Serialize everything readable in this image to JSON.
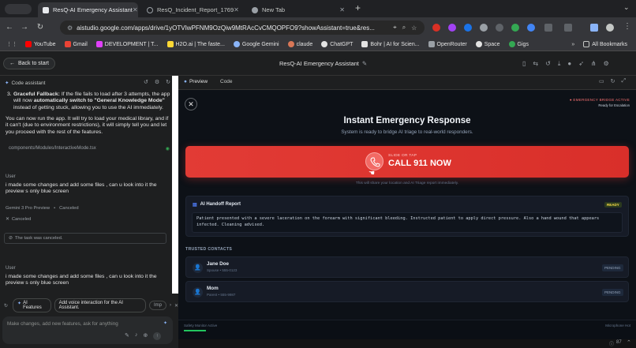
{
  "browser": {
    "tabs": [
      {
        "title": "ResQ-AI Emergency Assistant",
        "active": true
      },
      {
        "title": "ResQ_Incident_Report_1769",
        "active": false
      },
      {
        "title": "New Tab",
        "active": false
      }
    ],
    "url": "aistudio.google.com/apps/drive/1yOTVIwPFNM9OzQiw9MtRAcCvCMQOPFO9?showAssistant=true&res...",
    "bookmarks": [
      "YouTube",
      "Gmail",
      "DEVELOPMENT | T...",
      "H2O.ai | The faste...",
      "Google Gemini",
      "claude",
      "ChatGPT",
      "Bohr | AI for Scien...",
      "OpenRouter",
      "Space",
      "Gigs"
    ],
    "all_bookmarks_label": "All Bookmarks"
  },
  "app": {
    "back_label": "Back to start",
    "title": "ResQ-AI Emergency Assistant"
  },
  "assistant": {
    "header_label": "Code assistant",
    "fallback_title": "Graceful Fallback:",
    "fallback_text_1": " If the file fails to load after 3 attempts, the app will now ",
    "fallback_bold": "automatically switch to \"General Knowledge Mode\"",
    "fallback_text_2": " instead of getting stuck, allowing you to use the AI immediately.",
    "run_text": "You can now run the app. It will try to load your medical library, and if it can't (due to environment restrictions), it will simply tell you and let you proceed with the rest of the features.",
    "file_name": "components/Modules/InteractiveMode.tsx",
    "messages": [
      {
        "role": "User",
        "text": "i made some changes and add some files , can u look into it the preview s only blue screen"
      },
      {
        "role": "User",
        "text": "i made some changes and add some files , can u look into it the preview s only blue screen"
      }
    ],
    "model_label": "Gemini 3 Pro Preview",
    "canceled_status": "Canceled",
    "canceled_badge": "Canceled",
    "canceled_note": "The task was canceled.",
    "chips": [
      "AI Features",
      "Add voice interaction for the AI Assistant.",
      "Imp"
    ],
    "input_placeholder": "Make changes, add new features, ask for anything"
  },
  "preview": {
    "tabs": [
      "Preview",
      "Code"
    ],
    "status_top": "● EMERGENCY BRIDGE ACTIVE",
    "status_sub": "Ready for Escalation",
    "heading": "Instant Emergency Response",
    "subheading": "System is ready to bridge AI triage to real-world responders.",
    "call_small": "SLIDE OR TAP",
    "call_big": "CALL 911 NOW",
    "call_note": "This will share your location and AI Triage report immediately.",
    "handoff_title": "AI Handoff Report",
    "handoff_badge": "READY",
    "handoff_text": "Patient presented with a severe laceration on the forearm with significant bleeding. Instructed patient to apply direct pressure. Also a hand wound that appears infected. Cleaning advised.",
    "contacts_label": "TRUSTED CONTACTS",
    "contacts": [
      {
        "name": "Jane Doe",
        "detail": "Spouse • 555-0123",
        "status": "PENDING"
      },
      {
        "name": "Mom",
        "detail": "Parent • 555-9987",
        "status": "PENDING"
      }
    ],
    "footer_left": "Safety Monitor Active",
    "footer_right": "Microphone Hot",
    "zoom": "87"
  },
  "colors": {
    "call_red": "#e53935",
    "accent_blue": "#4f7df9",
    "ready_yellow": "#fde047"
  }
}
